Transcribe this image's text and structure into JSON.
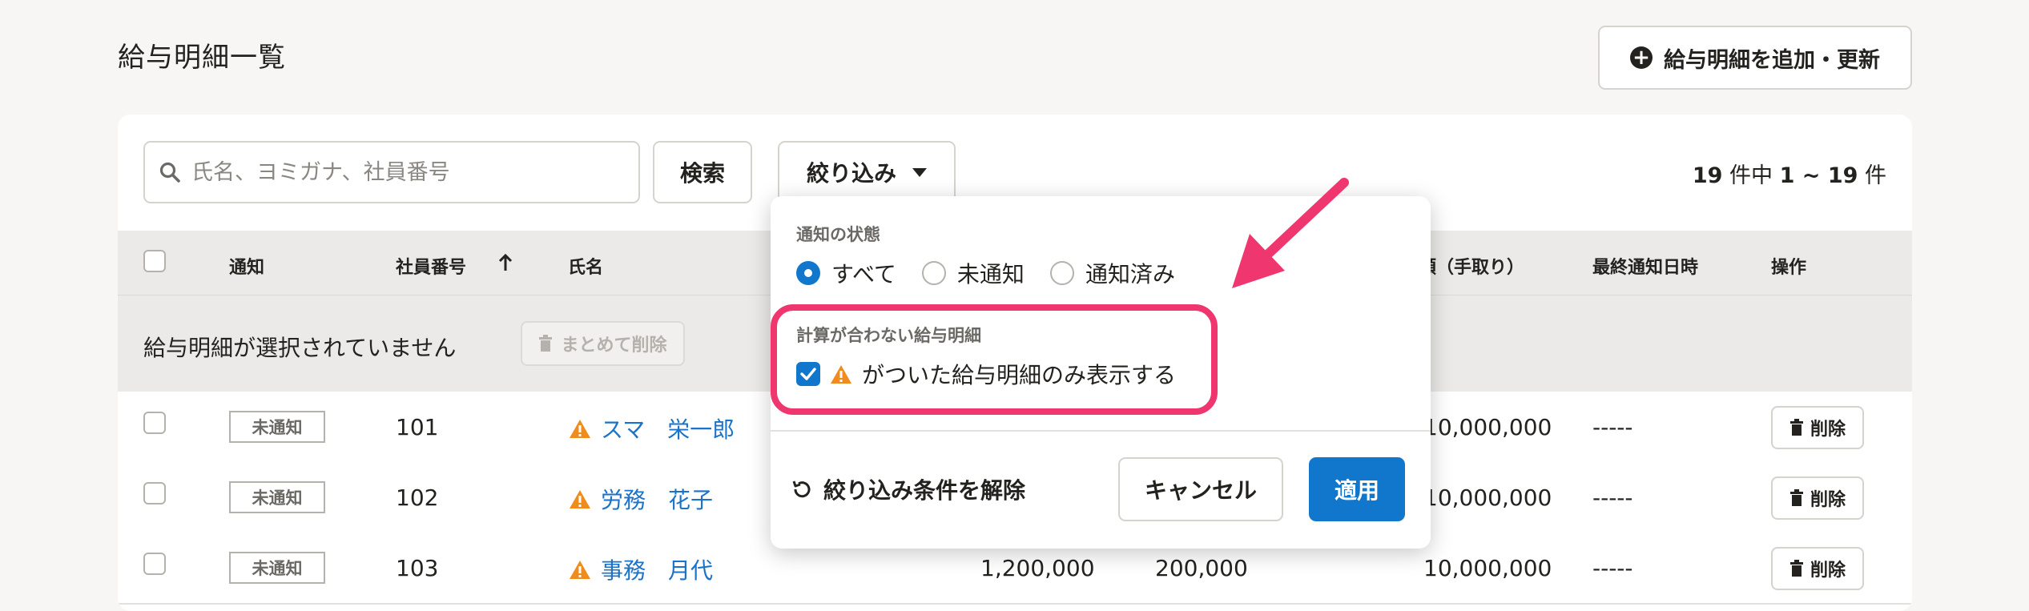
{
  "page": {
    "title": "給与明細一覧",
    "add_button": "給与明細を追加・更新"
  },
  "toolbar": {
    "search_placeholder": "氏名、ヨミガナ、社員番号",
    "search_button": "検索",
    "filter_button": "絞り込み",
    "count_prefix": "19",
    "count_mid": " 件中 ",
    "count_range": "1 ~ 19",
    "count_suffix": " 件"
  },
  "table": {
    "headers": {
      "notify": "通知",
      "employee_no": "社員番号",
      "name": "氏名",
      "net_amount": "額（手取り）",
      "last_notified": "最終通知日時",
      "actions": "操作"
    },
    "selection_text": "給与明細が選択されていません",
    "bulk_delete": "まとめて削除",
    "rows": [
      {
        "status": "未通知",
        "employee_no": "101",
        "name": "スマ　栄一郎",
        "col_a": "",
        "col_b": "",
        "net": "10,000,000",
        "last": "-----",
        "delete": "削除"
      },
      {
        "status": "未通知",
        "employee_no": "102",
        "name": "労務　花子",
        "col_a": "",
        "col_b": "",
        "net": "10,000,000",
        "last": "-----",
        "delete": "削除"
      },
      {
        "status": "未通知",
        "employee_no": "103",
        "name": "事務　月代",
        "col_a": "1,200,000",
        "col_b": "200,000",
        "net": "10,000,000",
        "last": "-----",
        "delete": "削除"
      }
    ]
  },
  "filter_panel": {
    "notify_label": "通知の状態",
    "options": [
      "すべて",
      "未通知",
      "通知済み"
    ],
    "selected": "すべて",
    "mismatch_label": "計算が合わない給与明細",
    "mismatch_option": "がついた給与明細のみ表示する",
    "mismatch_checked": true,
    "reset": "絞り込み条件を解除",
    "cancel": "キャンセル",
    "apply": "適用"
  },
  "colors": {
    "accent": "#1177cc",
    "highlight": "#f0366f",
    "warning": "#f08c1e",
    "link": "#1a73c8"
  }
}
